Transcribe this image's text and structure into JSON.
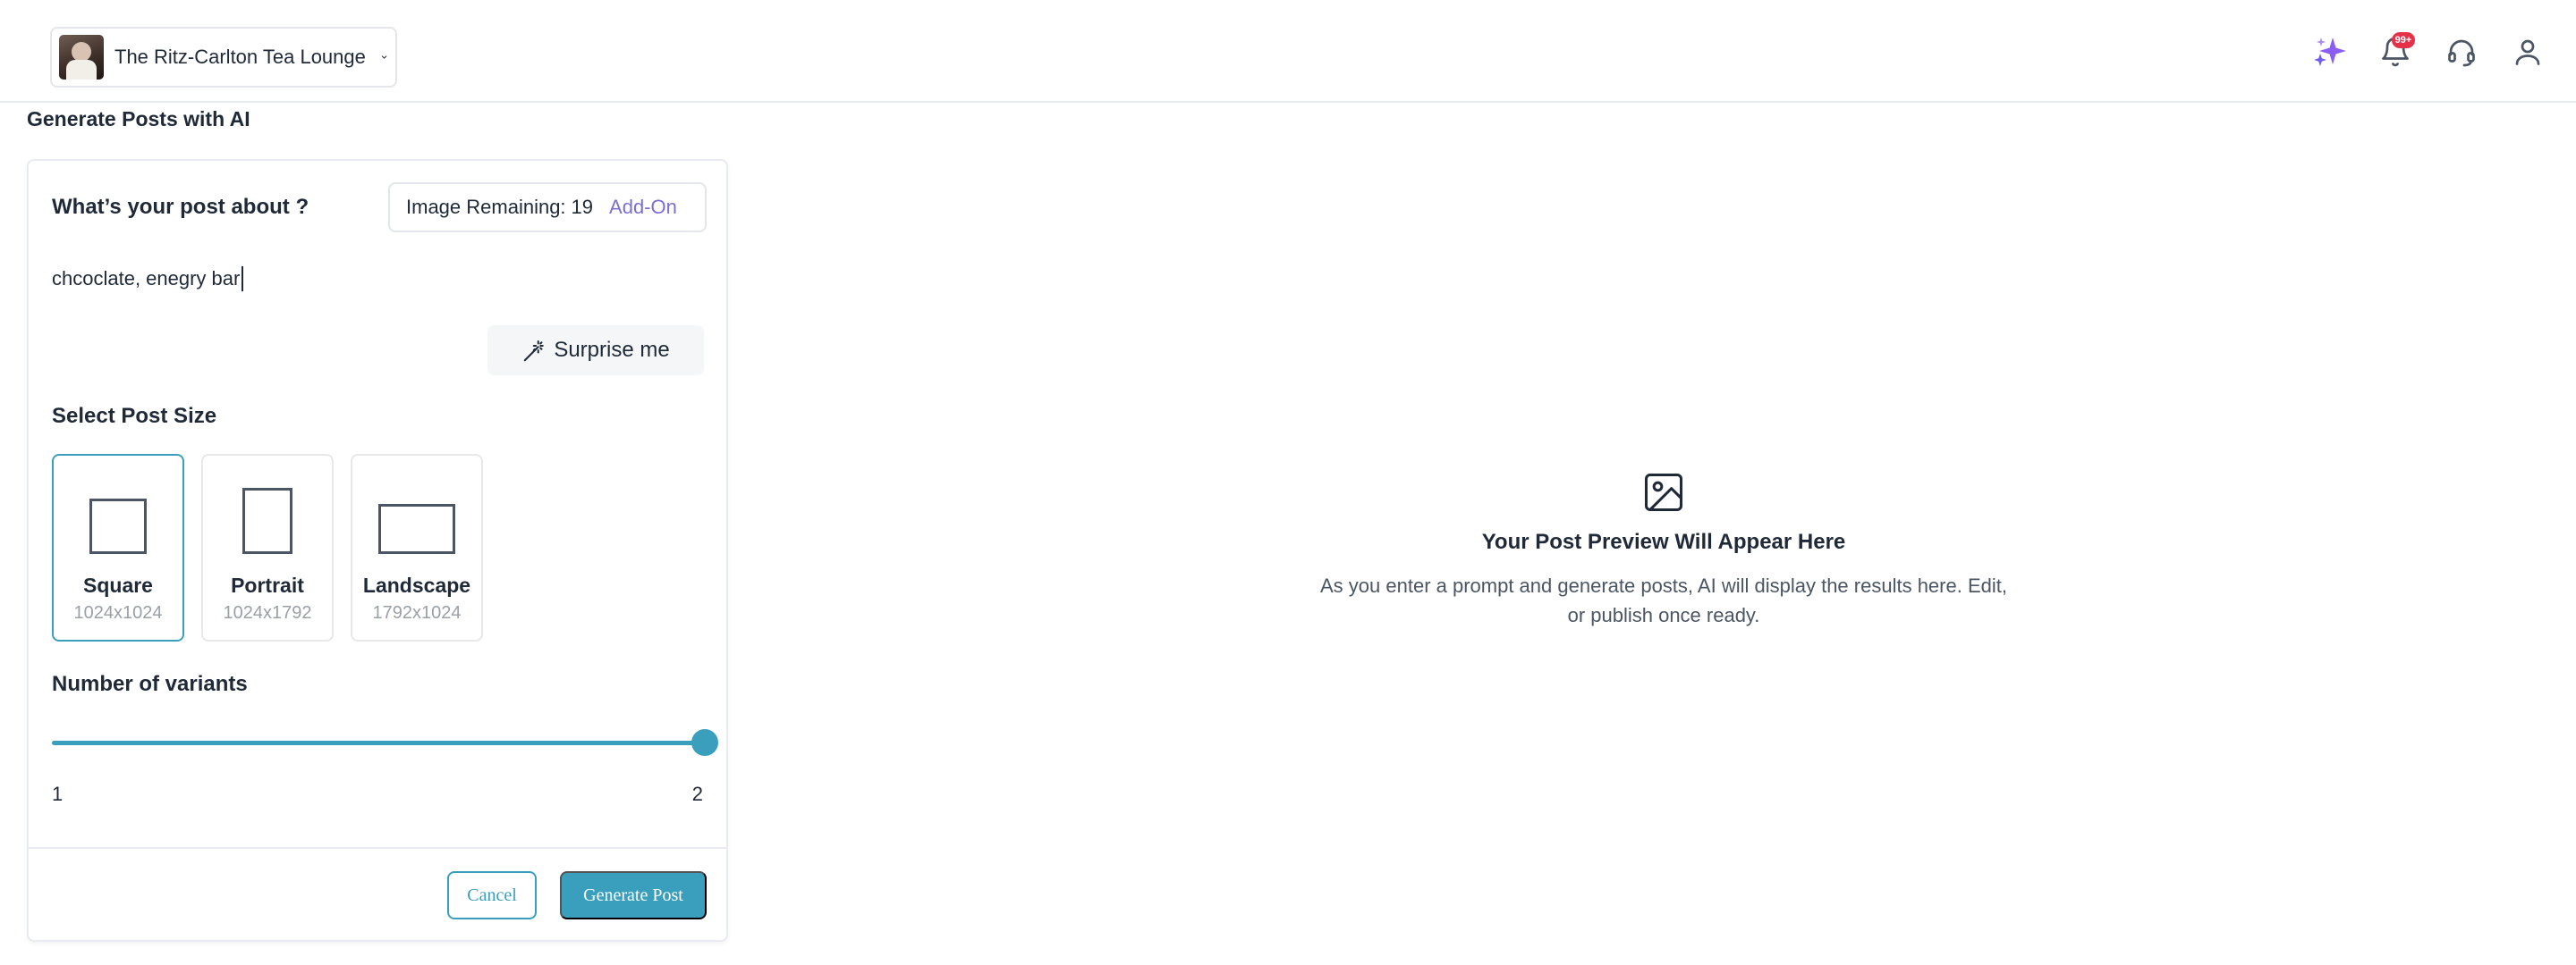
{
  "header": {
    "business_name": "The Ritz-Carlton Tea Lounge",
    "notification_badge": "99+",
    "icons": [
      "sparkle-icon",
      "bell-icon",
      "headset-icon",
      "user-icon"
    ],
    "accent_sparkle": "#8b5cf6"
  },
  "page": {
    "title": "Generate Posts with AI"
  },
  "form": {
    "question_label": "What’s your post about ?",
    "image_remaining_label": "Image Remaining:",
    "image_remaining_count": "19",
    "addon_label": "Add-On",
    "prompt_value": "chcoclate, enegry bar",
    "surprise_label": "Surprise me",
    "size_label": "Select Post Size",
    "sizes": [
      {
        "name": "Square",
        "dims": "1024x1024",
        "selected": true
      },
      {
        "name": "Portrait",
        "dims": "1024x1792",
        "selected": false
      },
      {
        "name": "Landscape",
        "dims": "1792x1024",
        "selected": false
      }
    ],
    "variants_label": "Number of variants",
    "variants": {
      "min": "1",
      "max": "2",
      "value": 2
    },
    "cancel_label": "Cancel",
    "generate_label": "Generate Post"
  },
  "preview": {
    "title": "Your Post Preview Will Appear Here",
    "description": "As you enter a prompt and generate posts, AI will display the results here. Edit, or publish once ready."
  },
  "colors": {
    "primary": "#3a9fbd",
    "addon": "#7b6fd6",
    "badge": "#e5304a"
  }
}
